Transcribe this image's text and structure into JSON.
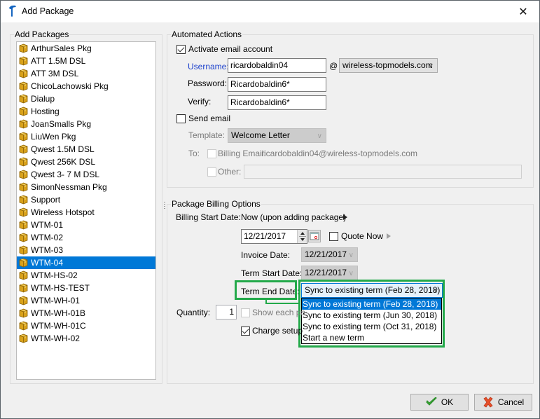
{
  "window": {
    "title": "Add Package",
    "close_symbol": "✕"
  },
  "packages_group": {
    "legend": "Add Packages",
    "items": [
      {
        "label": "ArthurSales Pkg",
        "selected": false
      },
      {
        "label": "ATT 1.5M DSL",
        "selected": false
      },
      {
        "label": "ATT 3M DSL",
        "selected": false
      },
      {
        "label": "ChicoLachowski Pkg",
        "selected": false
      },
      {
        "label": "Dialup",
        "selected": false
      },
      {
        "label": "Hosting",
        "selected": false
      },
      {
        "label": "JoanSmalls Pkg",
        "selected": false
      },
      {
        "label": "LiuWen Pkg",
        "selected": false
      },
      {
        "label": "Qwest 1.5M DSL",
        "selected": false
      },
      {
        "label": "Qwest 256K DSL",
        "selected": false
      },
      {
        "label": "Qwest 3- 7 M DSL",
        "selected": false
      },
      {
        "label": "SimonNessman Pkg",
        "selected": false
      },
      {
        "label": "Support",
        "selected": false
      },
      {
        "label": "Wireless Hotspot",
        "selected": false
      },
      {
        "label": "WTM-01",
        "selected": false
      },
      {
        "label": "WTM-02",
        "selected": false
      },
      {
        "label": "WTM-03",
        "selected": false
      },
      {
        "label": "WTM-04",
        "selected": true
      },
      {
        "label": "WTM-HS-02",
        "selected": false
      },
      {
        "label": "WTM-HS-TEST",
        "selected": false
      },
      {
        "label": "WTM-WH-01",
        "selected": false
      },
      {
        "label": "WTM-WH-01B",
        "selected": false
      },
      {
        "label": "WTM-WH-01C",
        "selected": false
      },
      {
        "label": "WTM-WH-02",
        "selected": false
      }
    ]
  },
  "automated_actions": {
    "legend": "Automated Actions",
    "activate_email_label": "Activate email account",
    "activate_email_checked": true,
    "username_label": "Username:",
    "username_value": "ricardobaldin04",
    "at_symbol": "@",
    "domain_value": "wireless-topmodels.com",
    "password_label": "Password:",
    "password_value": "Ricardobaldin6*",
    "verify_label": "Verify:",
    "verify_value": "Ricardobaldin6*",
    "send_email_label": "Send email",
    "send_email_checked": false,
    "template_label": "Template:",
    "template_value": "Welcome Letter",
    "to_label": "To:",
    "billing_email_label": "Billing Email:",
    "billing_email_value": "ricardobaldin04@wireless-topmodels.com",
    "other_label": "Other:",
    "other_value": ""
  },
  "billing_options": {
    "legend": "Package Billing Options",
    "billing_start_label": "Billing Start Date:",
    "billing_start_value": "Now (upon adding package)",
    "start_date_value": "12/21/2017",
    "quote_now_label": "Quote Now",
    "quote_now_checked": false,
    "invoice_date_label": "Invoice Date:",
    "invoice_date_value": "12/21/2017",
    "term_start_label": "Term Start Date:",
    "term_start_value": "12/21/2017",
    "term_end_label": "Term End Date:",
    "term_end_value": "Sync to existing term (Feb 28, 2018)",
    "term_end_options": [
      "Sync to existing term (Feb 28, 2018)",
      "Sync to existing term (Jun 30, 2018)",
      "Sync to existing term (Oct 31, 2018)",
      "Start a new term"
    ],
    "term_end_selected_index": 0,
    "quantity_label": "Quantity:",
    "quantity_value": "1",
    "show_each_label": "Show each pa",
    "show_each_checked": false,
    "charge_setup_label": "Charge setup",
    "charge_setup_checked": true
  },
  "footer": {
    "ok_label": "OK",
    "cancel_label": "Cancel"
  },
  "colors": {
    "highlight": "#0078d7",
    "annotation_green": "#23a94a",
    "link_blue": "#1a3fcc"
  }
}
